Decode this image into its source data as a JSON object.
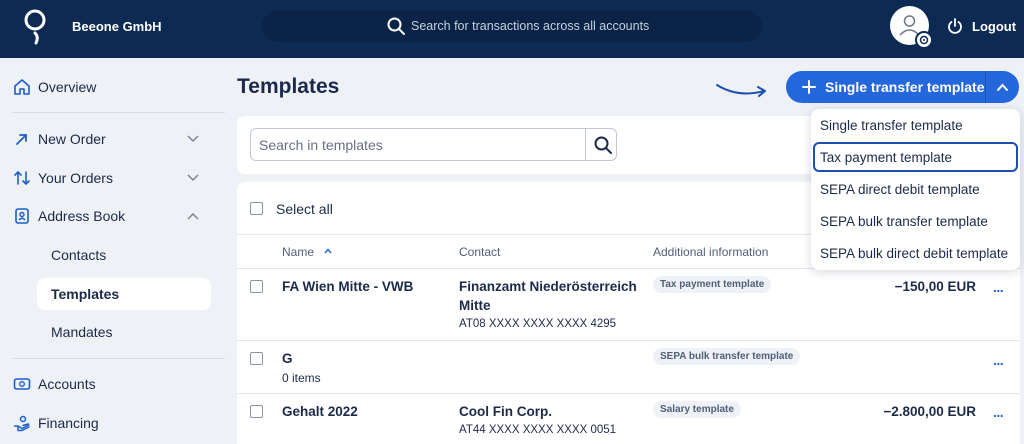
{
  "header": {
    "company": "Beeone GmbH",
    "search_placeholder": "Search for transactions across all accounts",
    "logout_label": "Logout"
  },
  "sidebar": {
    "items": [
      {
        "label": "Overview",
        "icon": "home-icon"
      },
      {
        "label": "New Order",
        "icon": "arrow-up-right-icon"
      },
      {
        "label": "Your Orders",
        "icon": "swap-vertical-icon"
      },
      {
        "label": "Address Book",
        "icon": "address-book-icon"
      },
      {
        "label": "Accounts",
        "icon": "money-icon"
      },
      {
        "label": "Financing",
        "icon": "financing-icon"
      }
    ],
    "sub_items": [
      {
        "label": "Contacts"
      },
      {
        "label": "Templates",
        "active": true
      },
      {
        "label": "Mandates"
      }
    ]
  },
  "main": {
    "title": "Templates",
    "primary_button": "Single transfer template",
    "search_placeholder": "Search in templates",
    "select_all": "Select all",
    "columns": {
      "name": "Name",
      "contact": "Contact",
      "additional": "Additional information"
    },
    "rows": [
      {
        "name": "FA Wien Mitte - VWB",
        "contact_name": "Finanzamt Niederösterreich Mitte",
        "iban": "AT08 XXXX XXXX XXXX 4295",
        "tag": "Tax payment template",
        "amount": "−150,00 EUR"
      },
      {
        "name": "G",
        "sub": "0 items",
        "tag": "SEPA bulk transfer template"
      },
      {
        "name": "Gehalt 2022",
        "contact_name": "Cool Fin Corp.",
        "iban": "AT44 XXXX XXXX XXXX 0051",
        "tag": "Salary template",
        "amount": "−2.800,00 EUR"
      }
    ],
    "more_label": "..."
  },
  "dropdown": {
    "items": [
      {
        "label": "Single transfer template"
      },
      {
        "label": "Tax payment template",
        "focused": true
      },
      {
        "label": "SEPA direct debit template"
      },
      {
        "label": "SEPA bulk transfer template"
      },
      {
        "label": "SEPA bulk direct debit template"
      }
    ]
  },
  "colors": {
    "header_bg": "#0d2a52",
    "accent": "#2466dc",
    "page_bg": "#eef1f5"
  }
}
